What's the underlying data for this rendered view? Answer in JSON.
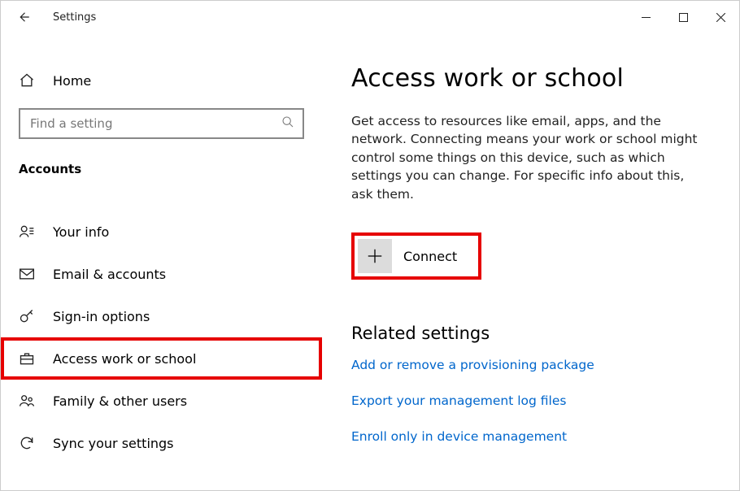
{
  "window": {
    "title": "Settings"
  },
  "sidebar": {
    "home_label": "Home",
    "search_placeholder": "Find a setting",
    "category_label": "Accounts",
    "items": [
      {
        "label": "Your info"
      },
      {
        "label": "Email & accounts"
      },
      {
        "label": "Sign-in options"
      },
      {
        "label": "Access work or school"
      },
      {
        "label": "Family & other users"
      },
      {
        "label": "Sync your settings"
      }
    ]
  },
  "main": {
    "page_title": "Access work or school",
    "description": "Get access to resources like email, apps, and the network. Connecting means your work or school might control some things on this device, such as which settings you can change. For specific info about this, ask them.",
    "connect_label": "Connect",
    "related_title": "Related settings",
    "links": [
      "Add or remove a provisioning package",
      "Export your management log files",
      "Enroll only in device management"
    ]
  }
}
